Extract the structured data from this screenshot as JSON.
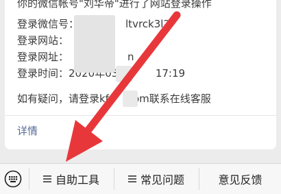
{
  "message": {
    "line_top_partial": "你的微信帐号\"刘华帝\"进行了网站登录操作",
    "account_label": "登录微信号：",
    "account_value": "ltvrck3l2",
    "site_label": "登录网站：",
    "url_label": "登录网址：",
    "url_value_tail": "n",
    "time_label": "登录时间：",
    "time_value_start": "2020年03月0",
    "time_value_end": "17:19",
    "contact_start": "如有疑问，请登录kf",
    "contact_end": ".com联系在线客服",
    "detail_link": "详情"
  },
  "bottom_menu": {
    "keyboard_icon": "keyboard-icon",
    "items": [
      {
        "label": "自助工具",
        "icon": "hamburger-icon"
      },
      {
        "label": "常见问题",
        "icon": "hamburger-icon"
      },
      {
        "label": "意见反馈"
      }
    ]
  },
  "colors": {
    "arrow": "#e8373b",
    "link": "#576b95",
    "card_background": "#ffffff",
    "page_background": "#ececec"
  }
}
